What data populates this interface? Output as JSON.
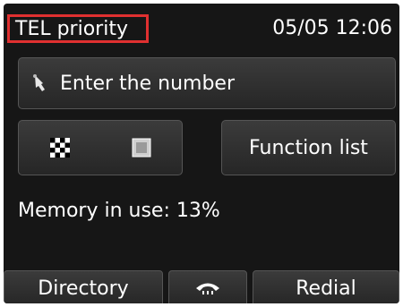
{
  "status": {
    "mode": "TEL priority",
    "datetime": "05/05 12:06"
  },
  "input": {
    "label": "Enter the number",
    "icon": "touch-hand-icon"
  },
  "mode_buttons": {
    "icons": [
      "checkerboard-icon",
      "photo-icon"
    ]
  },
  "function_list": {
    "label": "Function list"
  },
  "memory": {
    "text": "Memory in use: 13%"
  },
  "bottom": {
    "directory": "Directory",
    "hook_icon": "on-hook-phone-icon",
    "redial": "Redial"
  },
  "colors": {
    "background": "#161616",
    "button": "#2e2e2e",
    "mode_highlight": "#e03030",
    "text": "#ffffff"
  }
}
